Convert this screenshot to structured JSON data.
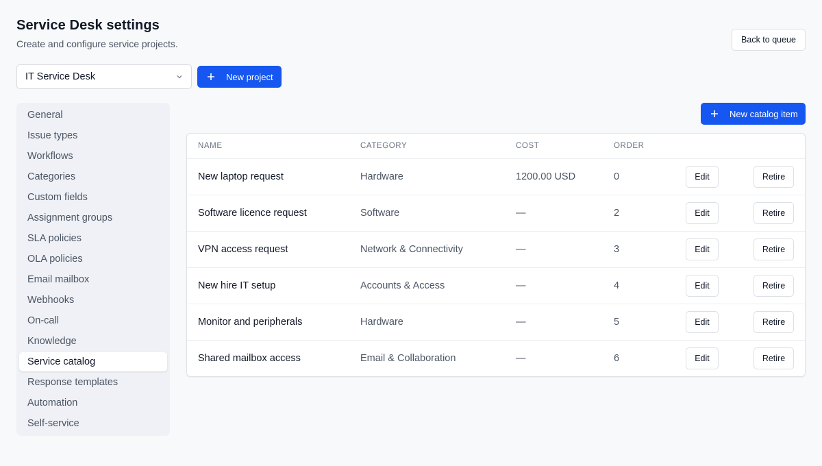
{
  "header": {
    "title": "Service Desk settings",
    "subtitle": "Create and configure service projects.",
    "back_label": "Back to queue"
  },
  "project_select": {
    "value": "IT Service Desk",
    "icon": "chevron-down-icon"
  },
  "actions": {
    "new_project_label": "New project",
    "new_catalog_item_label": "New catalog item",
    "plus_icon": "plus-icon"
  },
  "sidebar": {
    "active": "Service catalog",
    "items": [
      {
        "label": "General"
      },
      {
        "label": "Issue types"
      },
      {
        "label": "Workflows"
      },
      {
        "label": "Categories"
      },
      {
        "label": "Custom fields"
      },
      {
        "label": "Assignment groups"
      },
      {
        "label": "SLA policies"
      },
      {
        "label": "OLA policies"
      },
      {
        "label": "Email mailbox"
      },
      {
        "label": "Webhooks"
      },
      {
        "label": "On-call"
      },
      {
        "label": "Knowledge"
      },
      {
        "label": "Service catalog"
      },
      {
        "label": "Response templates"
      },
      {
        "label": "Automation"
      },
      {
        "label": "Self-service"
      }
    ]
  },
  "table": {
    "columns": [
      "NAME",
      "CATEGORY",
      "COST",
      "ORDER"
    ],
    "edit_label": "Edit",
    "retire_label": "Retire",
    "rows": [
      {
        "name": "New laptop request",
        "category": "Hardware",
        "cost": "1200.00 USD",
        "order": "0"
      },
      {
        "name": "Software licence request",
        "category": "Software",
        "cost": "—",
        "order": "2"
      },
      {
        "name": "VPN access request",
        "category": "Network & Connectivity",
        "cost": "—",
        "order": "3"
      },
      {
        "name": "New hire IT setup",
        "category": "Accounts & Access",
        "cost": "—",
        "order": "4"
      },
      {
        "name": "Monitor and peripherals",
        "category": "Hardware",
        "cost": "—",
        "order": "5"
      },
      {
        "name": "Shared mailbox access",
        "category": "Email & Collaboration",
        "cost": "—",
        "order": "6"
      }
    ]
  },
  "colors": {
    "primary": "#1557f0",
    "page_bg": "#f8f9fb",
    "sidebar_bg": "#eff1f6"
  }
}
